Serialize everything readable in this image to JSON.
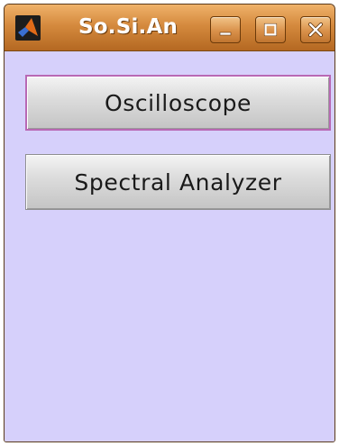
{
  "window": {
    "title": "So.Si.An"
  },
  "titlebar": {
    "app_icon": "matlab-logo-icon",
    "minimize_icon": "minimize-icon",
    "maximize_icon": "maximize-icon",
    "close_icon": "close-icon"
  },
  "buttons": [
    {
      "label": "Oscilloscope"
    },
    {
      "label": "Spectral Analyzer"
    }
  ],
  "colors": {
    "titlebar": "#d58a3e",
    "background": "#d6d0fb",
    "button_face": "#dddddd",
    "focus_border": "#b868b4"
  }
}
